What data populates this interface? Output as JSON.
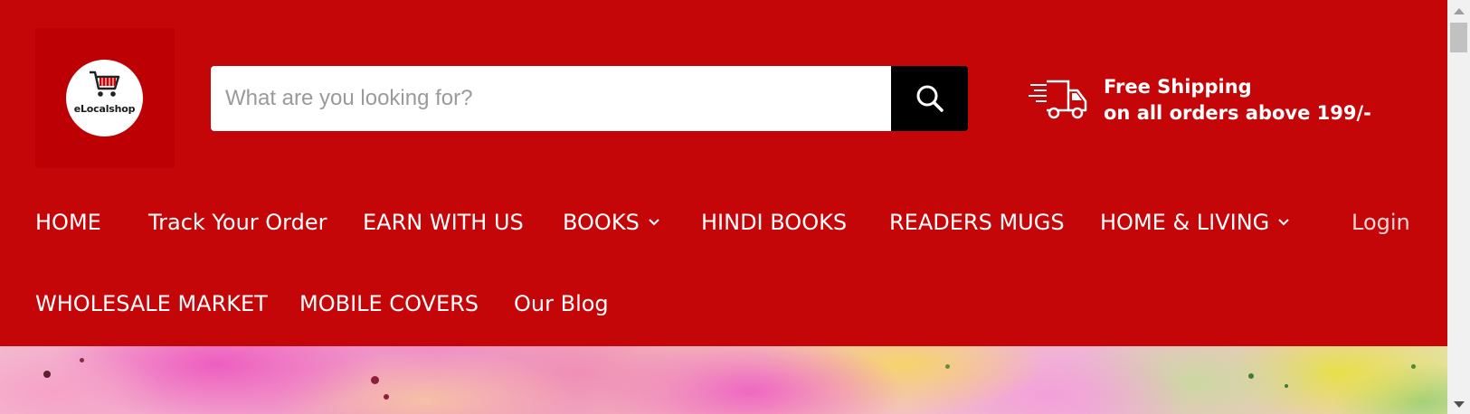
{
  "brand": {
    "logo_text": "eLocalshop",
    "accent_color": "#c50609"
  },
  "search": {
    "placeholder": "What are you looking for?",
    "value": "",
    "button_icon": "search-icon"
  },
  "shipping": {
    "icon": "truck-icon",
    "line1": "Free Shipping",
    "line2": "on all orders above 199/-"
  },
  "nav": {
    "items": [
      {
        "label": "HOME"
      },
      {
        "label": "Track Your Order"
      },
      {
        "label": "EARN WITH US"
      },
      {
        "label": "BOOKS",
        "dropdown": true
      },
      {
        "label": "HINDI BOOKS"
      },
      {
        "label": "READERS MUGS"
      },
      {
        "label": "HOME & LIVING",
        "dropdown": true
      },
      {
        "label": "WHOLESALE MARKET"
      },
      {
        "label": "MOBILE COVERS"
      },
      {
        "label": "Our Blog"
      }
    ],
    "login_label": "Login"
  }
}
